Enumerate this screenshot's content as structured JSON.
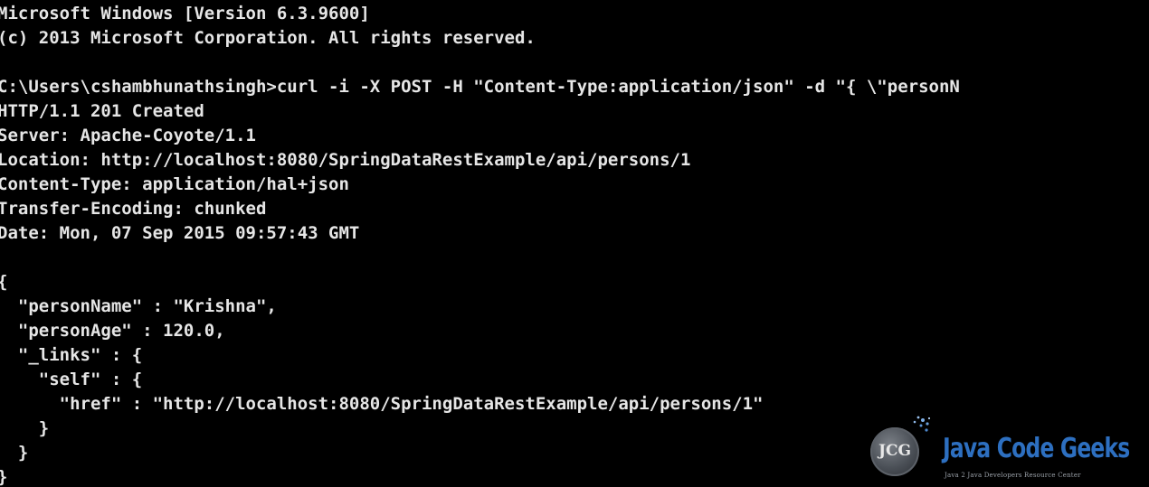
{
  "console": {
    "lines": [
      "Microsoft Windows [Version 6.3.9600]",
      "(c) 2013 Microsoft Corporation. All rights reserved.",
      "",
      "C:\\Users\\cshambhunathsingh>curl -i -X POST -H \"Content-Type:application/json\" -d \"{ \\\"personN",
      "HTTP/1.1 201 Created",
      "Server: Apache-Coyote/1.1",
      "Location: http://localhost:8080/SpringDataRestExample/api/persons/1",
      "Content-Type: application/hal+json",
      "Transfer-Encoding: chunked",
      "Date: Mon, 07 Sep 2015 09:57:43 GMT",
      "",
      "{",
      "  \"personName\" : \"Krishna\",",
      "  \"personAge\" : 120.0,",
      "  \"_links\" : {",
      "    \"self\" : {",
      "      \"href\" : \"http://localhost:8080/SpringDataRestExample/api/persons/1\"",
      "    }",
      "  }",
      "}"
    ]
  },
  "watermark": {
    "logo_text": "JCG",
    "brand": "Java Code Geeks",
    "tagline": "Java 2 Java Developers Resource Center",
    "brand_color": "#2d6fc0"
  },
  "colors": {
    "background": "#000000",
    "text": "#e6e6e6"
  }
}
